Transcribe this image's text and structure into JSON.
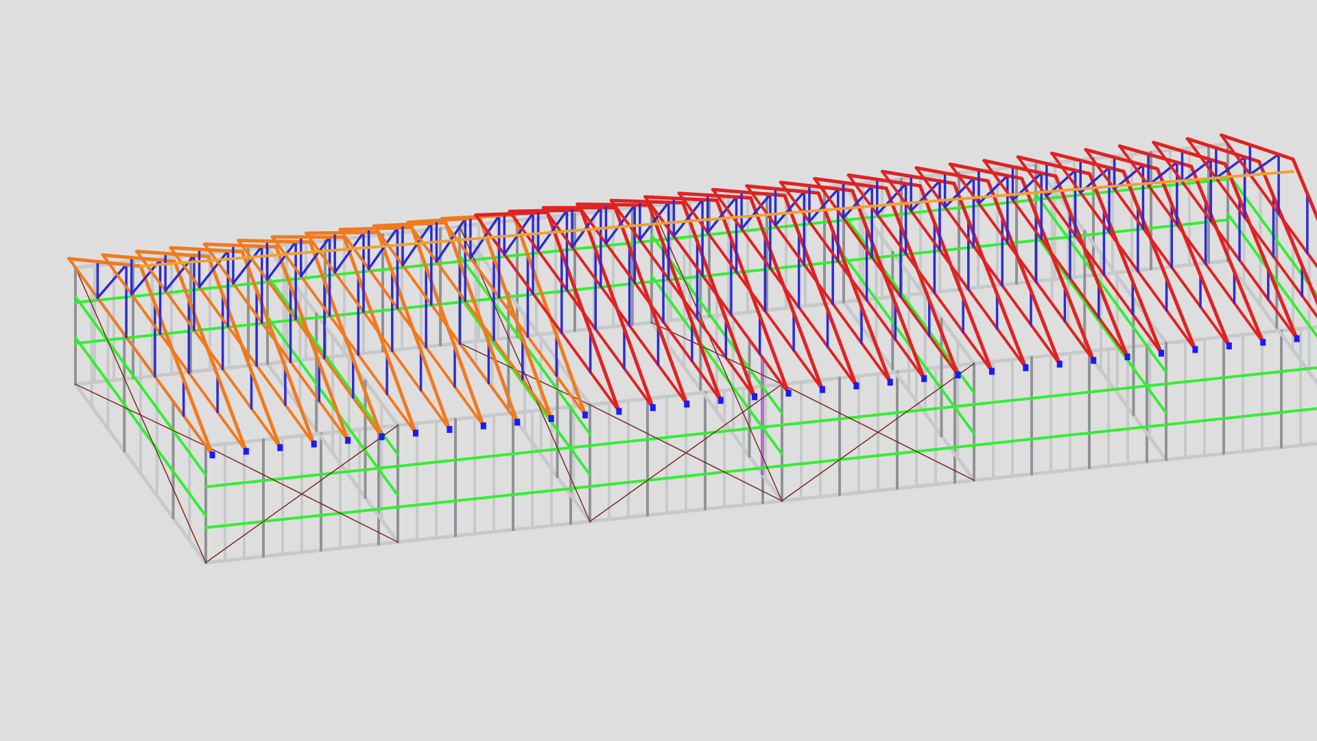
{
  "scene": {
    "background": "#dedede",
    "member_colors": {
      "wall_frame": "#c6c8ca",
      "wall_frame_dark": "#8f9296",
      "nogging": "#33ee33",
      "strap_brace": "#7a2a20",
      "truss_web": "#2b2bd6",
      "truss_chord": "#e02222",
      "girder_truss": "#f07a1e",
      "special_member": "#f0a030",
      "connector": "#1a1aff",
      "post": "#b070c8"
    },
    "modules": [
      {
        "id": "A",
        "wall_height": 1,
        "truss": "orange",
        "cross_brace": true
      },
      {
        "id": "B",
        "wall_height": 1,
        "truss": "orange",
        "cross_brace": false
      },
      {
        "id": "C",
        "wall_height": 1,
        "truss": "red",
        "cross_brace": true
      },
      {
        "id": "D",
        "wall_height": 1,
        "truss": "red",
        "cross_brace": true
      },
      {
        "id": "E",
        "wall_height": 1,
        "truss": "red",
        "cross_brace": false
      },
      {
        "id": "F",
        "wall_height": 1,
        "truss": "red",
        "cross_brace": false
      }
    ]
  }
}
